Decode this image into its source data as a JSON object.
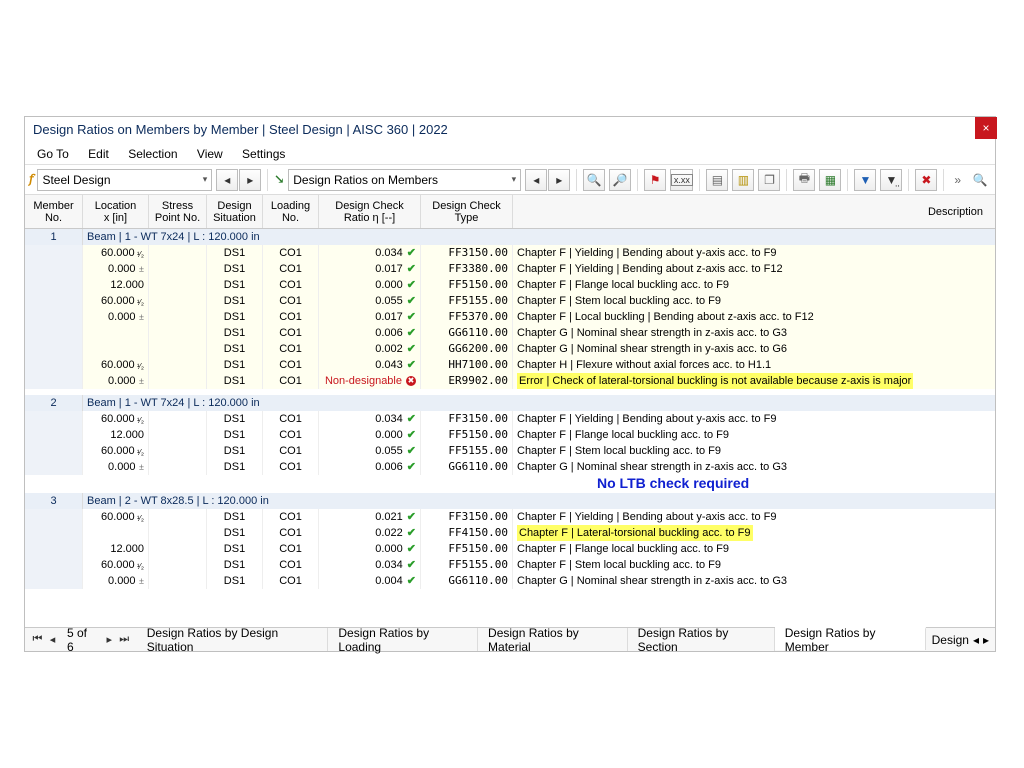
{
  "window": {
    "title": "Design Ratios on Members by Member | Steel Design | AISC 360 | 2022"
  },
  "menu": [
    "Go To",
    "Edit",
    "Selection",
    "View",
    "Settings"
  ],
  "combos": {
    "left": "Steel Design",
    "right": "Design Ratios on Members"
  },
  "columns": {
    "member": "Member\nNo.",
    "location": "Location\nx [in]",
    "stress": "Stress\nPoint No.",
    "situation": "Design\nSituation",
    "loading": "Loading\nNo.",
    "ratio": "Design Check\nRatio η [--]",
    "type": "Design Check\nType",
    "desc": "Description"
  },
  "groups": [
    {
      "no": "1",
      "label": "Beam | 1 - WT 7x24 | L : 120.000 in",
      "rows": [
        {
          "loc": "60.000",
          "half": true,
          "pm": false,
          "ds": "DS1",
          "co": "CO1",
          "ratio": "0.034",
          "ok": true,
          "code": "FF3150.00",
          "desc": "Chapter F | Yielding | Bending about y-axis acc. to F9"
        },
        {
          "loc": "0.000",
          "half": false,
          "pm": true,
          "ds": "DS1",
          "co": "CO1",
          "ratio": "0.017",
          "ok": true,
          "code": "FF3380.00",
          "desc": "Chapter F | Yielding | Bending about z-axis acc. to F12"
        },
        {
          "loc": "12.000",
          "half": false,
          "pm": false,
          "ds": "DS1",
          "co": "CO1",
          "ratio": "0.000",
          "ok": true,
          "code": "FF5150.00",
          "desc": "Chapter F | Flange local buckling acc. to F9"
        },
        {
          "loc": "60.000",
          "half": true,
          "pm": false,
          "ds": "DS1",
          "co": "CO1",
          "ratio": "0.055",
          "ok": true,
          "code": "FF5155.00",
          "desc": "Chapter F | Stem local buckling acc. to F9"
        },
        {
          "loc": "0.000",
          "half": false,
          "pm": true,
          "ds": "DS1",
          "co": "CO1",
          "ratio": "0.017",
          "ok": true,
          "code": "FF5370.00",
          "desc": "Chapter F | Local buckling | Bending about z-axis acc. to F12"
        },
        {
          "loc": "",
          "half": false,
          "pm": false,
          "ds": "DS1",
          "co": "CO1",
          "ratio": "0.006",
          "ok": true,
          "code": "GG6110.00",
          "desc": "Chapter G | Nominal shear strength in z-axis acc. to G3"
        },
        {
          "loc": "",
          "half": false,
          "pm": false,
          "ds": "DS1",
          "co": "CO1",
          "ratio": "0.002",
          "ok": true,
          "code": "GG6200.00",
          "desc": "Chapter G | Nominal shear strength in y-axis acc. to G6"
        },
        {
          "loc": "60.000",
          "half": true,
          "pm": false,
          "ds": "DS1",
          "co": "CO1",
          "ratio": "0.043",
          "ok": true,
          "code": "HH7100.00",
          "desc": "Chapter H | Flexure without axial forces acc. to H1.1"
        },
        {
          "loc": "0.000",
          "half": false,
          "pm": true,
          "ds": "DS1",
          "co": "CO1",
          "ratio": "Non-designable",
          "ok": false,
          "code": "ER9902.00",
          "desc": "Error | Check of lateral-torsional buckling is not available because z-axis is major",
          "descHL": true
        }
      ]
    },
    {
      "no": "2",
      "label": "Beam | 1 - WT 7x24 | L : 120.000 in",
      "rows": [
        {
          "loc": "60.000",
          "half": true,
          "pm": false,
          "ds": "DS1",
          "co": "CO1",
          "ratio": "0.034",
          "ok": true,
          "code": "FF3150.00",
          "desc": "Chapter F | Yielding | Bending about y-axis acc. to F9"
        },
        {
          "loc": "12.000",
          "half": false,
          "pm": false,
          "ds": "DS1",
          "co": "CO1",
          "ratio": "0.000",
          "ok": true,
          "code": "FF5150.00",
          "desc": "Chapter F | Flange local buckling acc. to F9"
        },
        {
          "loc": "60.000",
          "half": true,
          "pm": false,
          "ds": "DS1",
          "co": "CO1",
          "ratio": "0.055",
          "ok": true,
          "code": "FF5155.00",
          "desc": "Chapter F | Stem local buckling acc. to F9"
        },
        {
          "loc": "0.000",
          "half": false,
          "pm": true,
          "ds": "DS1",
          "co": "CO1",
          "ratio": "0.006",
          "ok": true,
          "code": "GG6110.00",
          "desc": "Chapter G | Nominal shear strength in z-axis acc. to G3"
        }
      ],
      "annotation": "No LTB check required"
    },
    {
      "no": "3",
      "label": "Beam | 2 - WT 8x28.5 | L : 120.000 in",
      "rows": [
        {
          "loc": "60.000",
          "half": true,
          "pm": false,
          "ds": "DS1",
          "co": "CO1",
          "ratio": "0.021",
          "ok": true,
          "code": "FF3150.00",
          "desc": "Chapter F | Yielding | Bending about y-axis acc. to F9"
        },
        {
          "loc": "",
          "half": false,
          "pm": false,
          "ds": "DS1",
          "co": "CO1",
          "ratio": "0.022",
          "ok": true,
          "code": "FF4150.00",
          "desc": "Chapter F | Lateral-torsional buckling acc. to F9",
          "descHL": true
        },
        {
          "loc": "12.000",
          "half": false,
          "pm": false,
          "ds": "DS1",
          "co": "CO1",
          "ratio": "0.000",
          "ok": true,
          "code": "FF5150.00",
          "desc": "Chapter F | Flange local buckling acc. to F9"
        },
        {
          "loc": "60.000",
          "half": true,
          "pm": false,
          "ds": "DS1",
          "co": "CO1",
          "ratio": "0.034",
          "ok": true,
          "code": "FF5155.00",
          "desc": "Chapter F | Stem local buckling acc. to F9"
        },
        {
          "loc": "0.000",
          "half": false,
          "pm": true,
          "ds": "DS1",
          "co": "CO1",
          "ratio": "0.004",
          "ok": true,
          "code": "GG6110.00",
          "desc": "Chapter G | Nominal shear strength in z-axis acc. to G3"
        }
      ]
    }
  ],
  "pager": "5 of 6",
  "tabs": [
    "Design Ratios by Design Situation",
    "Design Ratios by Loading",
    "Design Ratios by Material",
    "Design Ratios by Section",
    "Design Ratios by Member",
    "Design"
  ],
  "activeTab": 4
}
